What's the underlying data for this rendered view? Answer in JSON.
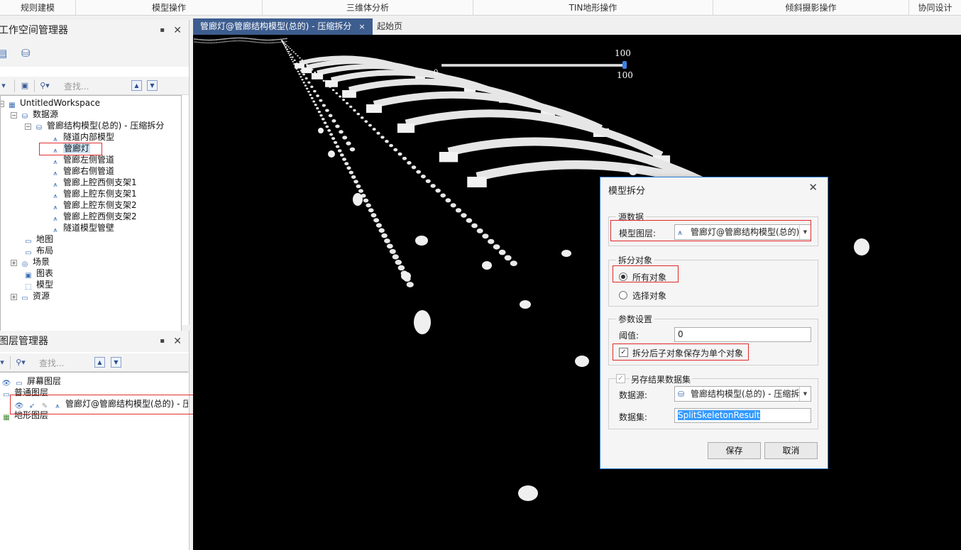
{
  "ribbon": {
    "groups": [
      "规则建模",
      "模型操作",
      "三维体分析",
      "TIN地形操作",
      "倾斜摄影操作",
      "协同设计"
    ]
  },
  "workspace_panel": {
    "title": "工作空间管理器",
    "search_placeholder": "查找...",
    "tree": {
      "workspace": "UntitledWorkspace",
      "datasources": "数据源",
      "datasource": "管廊结构模型(总的) - 压缩拆分",
      "datasets": [
        "隧道内部模型",
        "管廊灯",
        "管廊左侧管道",
        "管廊右侧管道",
        "管廊上腔西侧支架1",
        "管廊上腔东侧支架1",
        "管廊上腔东侧支架2",
        "管廊上腔西侧支架2",
        "隧道模型管壁"
      ],
      "maps": "地图",
      "layouts": "布局",
      "scenes": "场景",
      "charts": "图表",
      "models": "模型",
      "resources": "资源"
    }
  },
  "layer_panel": {
    "title": "图层管理器",
    "search_placeholder": "查找...",
    "screen_layer": "屏幕图层",
    "normal_layer": "普通图层",
    "layer_item": "管廊灯@管廊结构模型(总的) - 压",
    "terrain_layer": "地形图层"
  },
  "tabs": [
    {
      "label": "管廊灯@管廊结构模型(总的) - 压缩拆分",
      "close": "×"
    },
    {
      "label": "起始页"
    }
  ],
  "scene": {
    "slider_max_top": "100",
    "slider_min": "0",
    "slider_value": "100",
    "slider_fraction": 1.0
  },
  "dialog": {
    "title": "模型拆分",
    "close": "✕",
    "source_group": "源数据",
    "model_layer_label": "模型图层:",
    "model_layer_value": "管廊灯@管廊结构模型(总的)",
    "split_group": "拆分对象",
    "all_objects": "所有对象",
    "selected_objects": "选择对象",
    "params_group": "参数设置",
    "threshold_label": "阈值:",
    "threshold_value": "0",
    "save_single_label": "拆分后子对象保存为单个对象",
    "save_as_group": "另存结果数据集",
    "datasource_label": "数据源:",
    "datasource_value": "管廊结构模型(总的) - 压缩拆分",
    "dataset_label": "数据集:",
    "dataset_value": "SplitSkeletonResult",
    "save_button": "保存",
    "cancel_button": "取消"
  },
  "colors": {
    "accent": "#3d5d8f",
    "dialog_border": "#2b7fd8",
    "highlight": "#e02828",
    "scene_bg": "#000000"
  }
}
